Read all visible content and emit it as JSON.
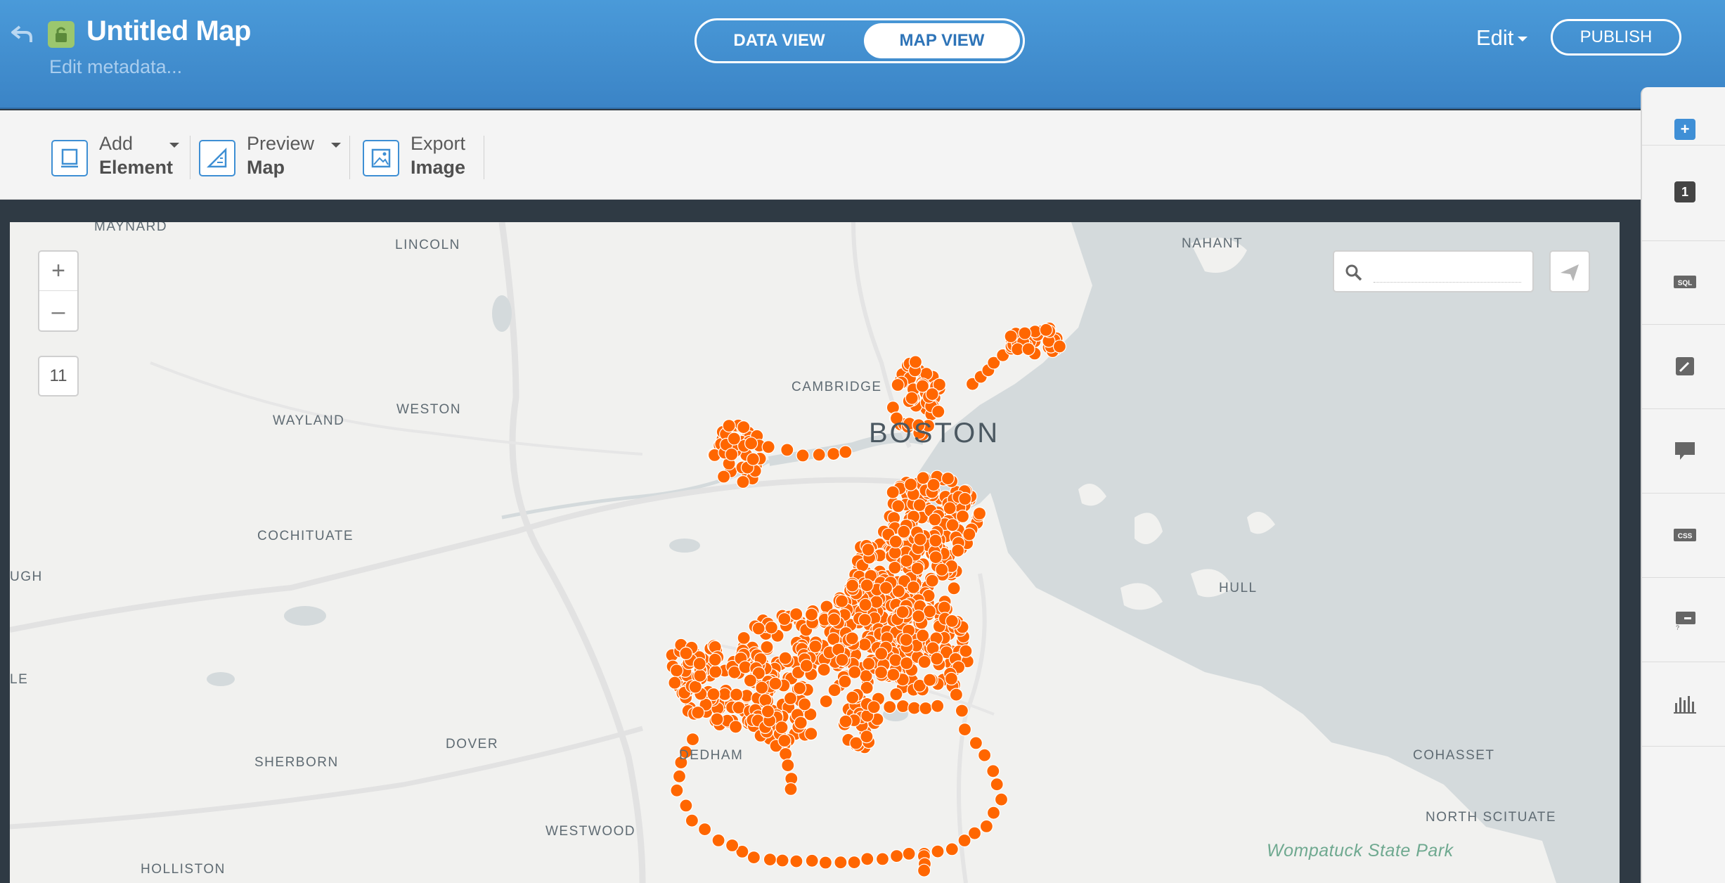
{
  "header": {
    "title": "Untitled Map",
    "metadata_link": "Edit metadata...",
    "views": {
      "data": "DATA VIEW",
      "map": "MAP VIEW",
      "active": "MAP VIEW"
    },
    "edit_menu": "Edit",
    "publish": "PUBLISH"
  },
  "toolbar": {
    "add_element": {
      "line1": "Add",
      "line2": "Element"
    },
    "preview_map": {
      "line1": "Preview",
      "line2": "Map"
    },
    "export_image": {
      "line1": "Export",
      "line2": "Image"
    }
  },
  "map": {
    "zoom_in": "+",
    "zoom_out": "–",
    "zoom_level": "11",
    "search_placeholder": "",
    "point_color": "#ff6600",
    "labels": {
      "maynard": "MAYNARD",
      "lincoln": "LINCOLN",
      "nahant": "NAHANT",
      "cambridge": "CAMBRIDGE",
      "boston": "BOSTON",
      "wayland": "WAYLAND",
      "weston": "WESTON",
      "cochituate": "COCHITUATE",
      "ugh": "UGH",
      "hull": "HULL",
      "le": "LE",
      "dedham": "DEDHAM",
      "dover": "DOVER",
      "sherborn": "SHERBORN",
      "cohasset": "COHASSET",
      "north_scituate": "NORTH SCITUATE",
      "westwood": "WESTWOOD",
      "wompatuck": "Wompatuck State Park",
      "holliston": "HOLLISTON"
    }
  },
  "right_panel": {
    "add_label": "+",
    "layer_number": "1",
    "icons": [
      "sql-icon",
      "wizard-icon",
      "infowindow-icon",
      "css-icon",
      "legend-icon",
      "chart-icon"
    ]
  },
  "colors": {
    "header": "#4a9ad9",
    "accent": "#3e8fd4",
    "water": "#d4dadc",
    "land": "#f1f1ef"
  }
}
